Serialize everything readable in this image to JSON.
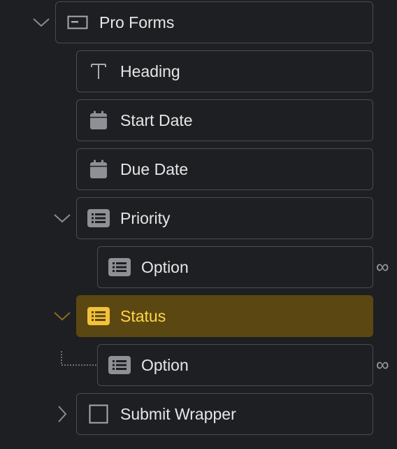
{
  "tree": {
    "pro_forms": {
      "label": "Pro Forms",
      "icon": "form-icon"
    },
    "heading": {
      "label": "Heading",
      "icon": "text-icon"
    },
    "start_date": {
      "label": "Start Date",
      "icon": "calendar-icon"
    },
    "due_date": {
      "label": "Due Date",
      "icon": "calendar-icon"
    },
    "priority": {
      "label": "Priority",
      "icon": "list-icon"
    },
    "priority_option": {
      "label": "Option",
      "icon": "list-icon",
      "link_glyph": "∞"
    },
    "status": {
      "label": "Status",
      "icon": "list-icon",
      "selected": true
    },
    "status_option": {
      "label": "Option",
      "icon": "list-icon",
      "link_glyph": "∞"
    },
    "submit_wrapper": {
      "label": "Submit Wrapper",
      "icon": "square-icon"
    }
  },
  "colors": {
    "background": "#1e1f22",
    "border": "#4a4c52",
    "text": "#e6e6e6",
    "selected_bg": "#5b4711",
    "selected_text": "#ffd54a"
  }
}
